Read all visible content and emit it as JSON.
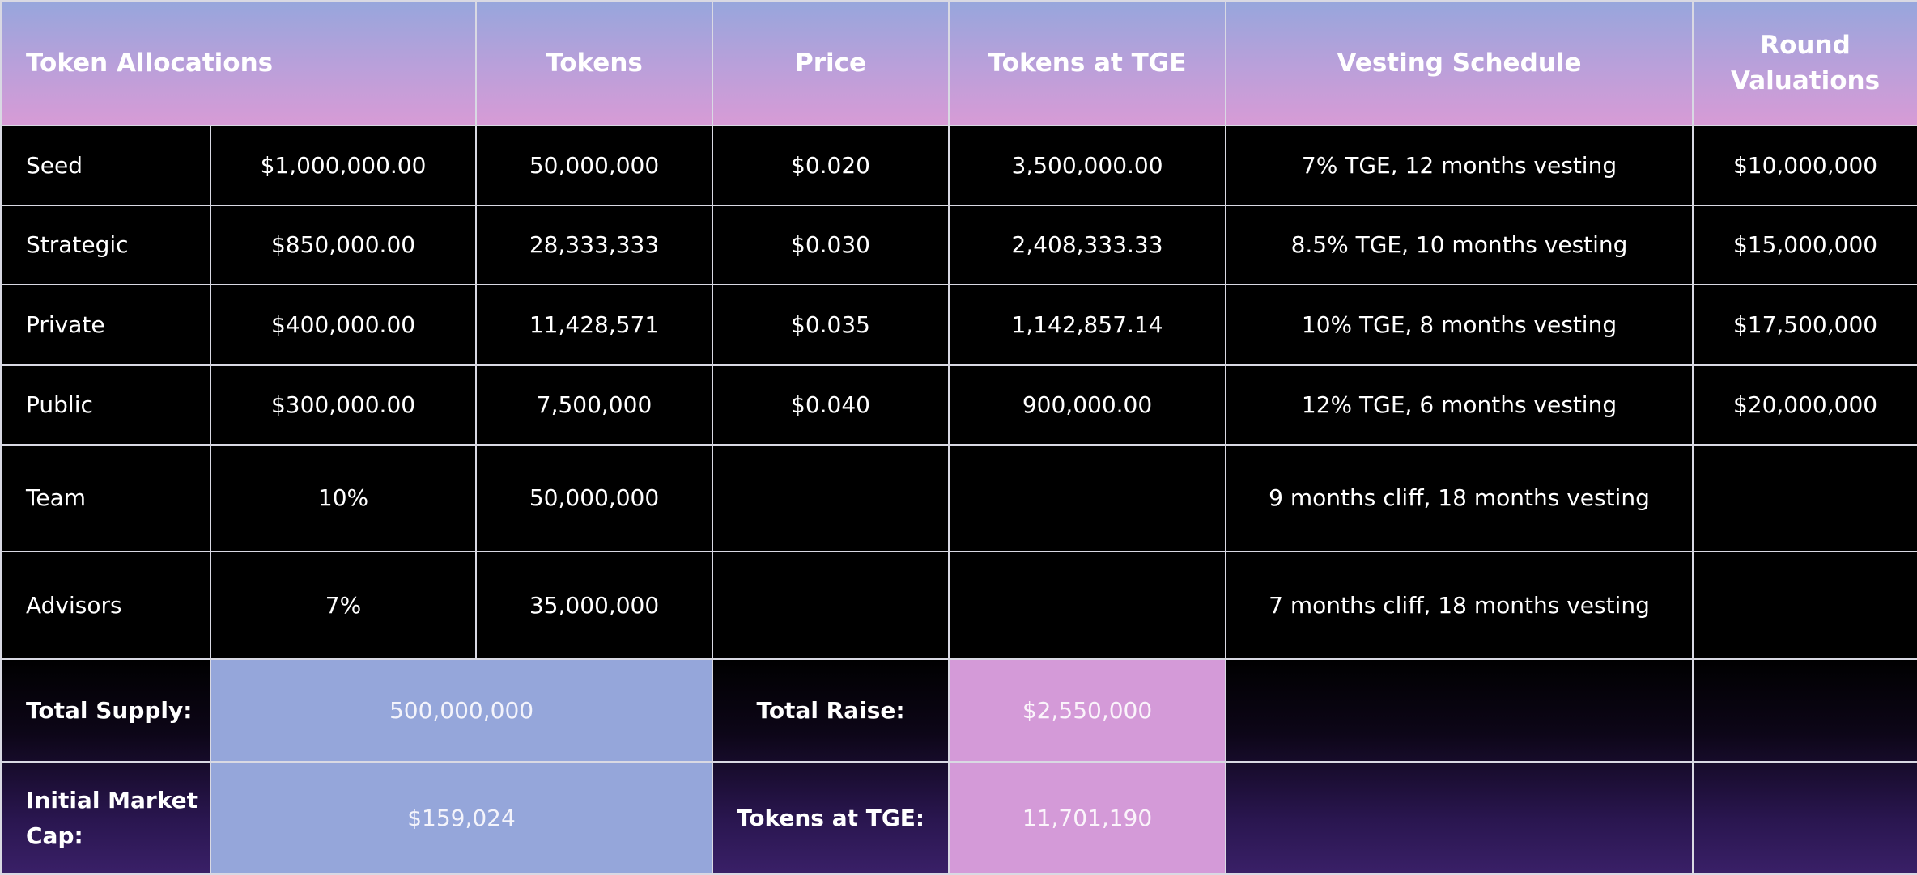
{
  "header": {
    "allocations": "Token Allocations",
    "tokens": "Tokens",
    "price": "Price",
    "tokens_at_tge": "Tokens at TGE",
    "vesting": "Vesting Schedule",
    "round_valuations": "Round Valuations"
  },
  "rows": [
    {
      "name": "Seed",
      "amount": "$1,000,000.00",
      "tokens": "50,000,000",
      "price": "$0.020",
      "tge": "3,500,000.00",
      "vesting": "7% TGE, 12 months vesting",
      "valuation": "$10,000,000"
    },
    {
      "name": "Strategic",
      "amount": "$850,000.00",
      "tokens": "28,333,333",
      "price": "$0.030",
      "tge": "2,408,333.33",
      "vesting": "8.5% TGE, 10 months vesting",
      "valuation": "$15,000,000"
    },
    {
      "name": "Private",
      "amount": "$400,000.00",
      "tokens": "11,428,571",
      "price": "$0.035",
      "tge": "1,142,857.14",
      "vesting": "10% TGE, 8 months vesting",
      "valuation": "$17,500,000"
    },
    {
      "name": "Public",
      "amount": "$300,000.00",
      "tokens": "7,500,000",
      "price": "$0.040",
      "tge": "900,000.00",
      "vesting": "12% TGE, 6 months vesting",
      "valuation": "$20,000,000"
    },
    {
      "name": "Team",
      "amount": "10%",
      "tokens": "50,000,000",
      "price": "",
      "tge": "",
      "vesting": "9 months cliff, 18 months vesting",
      "valuation": ""
    },
    {
      "name": "Advisors",
      "amount": "7%",
      "tokens": "35,000,000",
      "price": "",
      "tge": "",
      "vesting": "7 months cliff, 18 months vesting",
      "valuation": ""
    }
  ],
  "summary": {
    "total_supply_label": "Total Supply:",
    "total_supply_value": "500,000,000",
    "total_raise_label": "Total Raise:",
    "total_raise_value": "$2,550,000",
    "market_cap_label": "Initial Market Cap:",
    "market_cap_value": "$159,024",
    "tokens_tge_label": "Tokens at TGE:",
    "tokens_tge_value": "11,701,190"
  },
  "colors": {
    "header_top": "#97a6dc",
    "header_bottom": "#d79bd6",
    "summary_blue": "#95a6da",
    "summary_pink": "#d49ad8",
    "background": "#000000"
  }
}
